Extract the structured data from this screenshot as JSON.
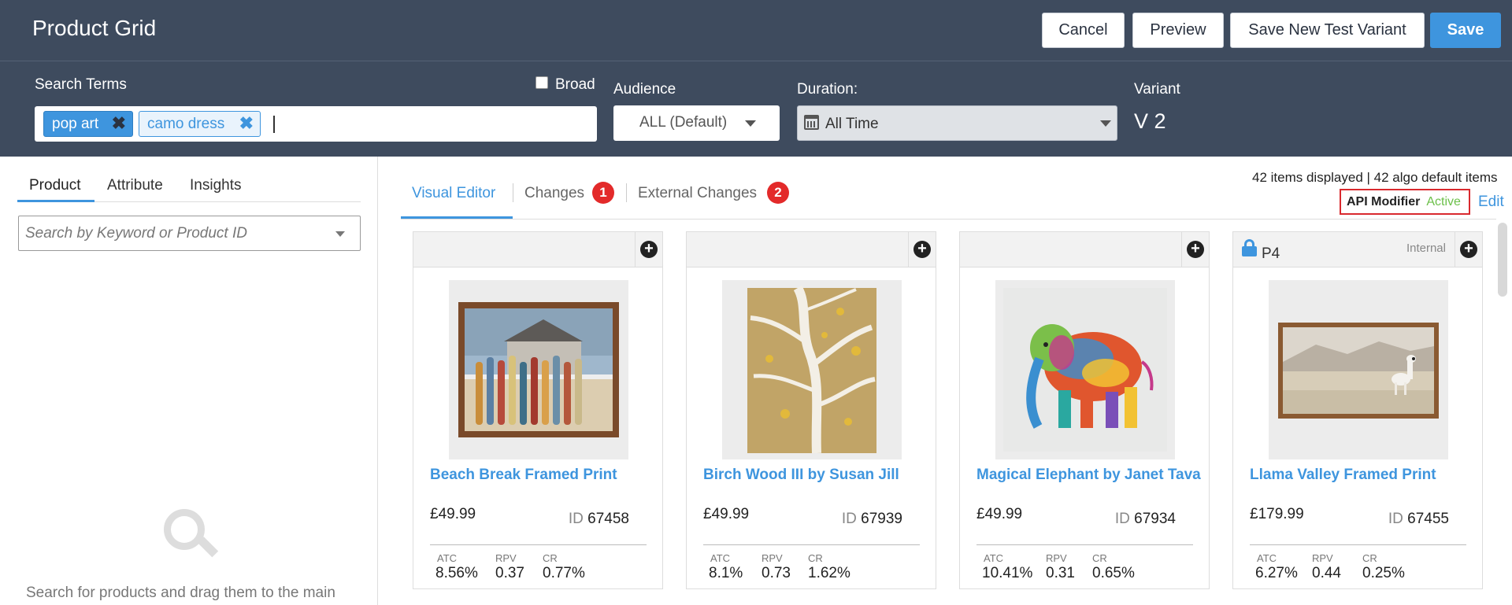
{
  "header": {
    "title": "Product Grid",
    "buttons": {
      "cancel": "Cancel",
      "preview": "Preview",
      "save_variant": "Save New Test Variant",
      "save": "Save"
    }
  },
  "filters": {
    "search_label": "Search Terms",
    "broad_label": "Broad",
    "broad_checked": false,
    "tags": [
      "pop art",
      "camo dress"
    ],
    "audience_label": "Audience",
    "audience_value": "ALL (Default)",
    "duration_label": "Duration:",
    "duration_value": "All Time",
    "variant_label": "Variant",
    "variant_value": "V 2"
  },
  "left_panel": {
    "tabs": [
      "Product",
      "Attribute",
      "Insights"
    ],
    "active_tab": "Product",
    "search_placeholder": "Search by Keyword or Product ID",
    "empty_hint": "Search for products and drag them to the main"
  },
  "main": {
    "tabs": [
      {
        "label": "Visual Editor",
        "badge": ""
      },
      {
        "label": "Changes",
        "badge": "1"
      },
      {
        "label": "External Changes",
        "badge": "2"
      }
    ],
    "items_info": "42 items displayed | 42 algo default items",
    "api_modifier_label": "API Modifier",
    "api_modifier_status": "Active",
    "edit_label": "Edit",
    "metric_labels": {
      "atc": "ATC",
      "rpv": "RPV",
      "cr": "CR"
    },
    "id_label": "ID"
  },
  "products": [
    {
      "name": "Beach Break Framed Print",
      "price": "£49.99",
      "id": "67458",
      "atc": "8.56%",
      "rpv": "0.37",
      "cr": "0.77%",
      "position_label": "",
      "internal": ""
    },
    {
      "name": "Birch Wood III by Susan Jill",
      "price": "£49.99",
      "id": "67939",
      "atc": "8.1%",
      "rpv": "0.73",
      "cr": "1.62%",
      "position_label": "",
      "internal": ""
    },
    {
      "name": "Magical Elephant by Janet Tava",
      "price": "£49.99",
      "id": "67934",
      "atc": "10.41%",
      "rpv": "0.31",
      "cr": "0.65%",
      "position_label": "",
      "internal": ""
    },
    {
      "name": "Llama Valley Framed Print",
      "price": "£179.99",
      "id": "67455",
      "atc": "6.27%",
      "rpv": "0.44",
      "cr": "0.25%",
      "position_label": "P4",
      "internal": "Internal"
    }
  ],
  "colors": {
    "header_bg": "#3e4b5e",
    "accent": "#3e95de",
    "badge": "#e32a2a",
    "active_status": "#6cc04a",
    "highlight_border": "#d9292e"
  },
  "icons": {
    "remove_tag": "close-icon",
    "add": "plus-circle-icon",
    "lock": "lock-icon",
    "calendar": "calendar-icon",
    "dropdown": "chevron-down-icon",
    "empty_search": "search-icon"
  }
}
